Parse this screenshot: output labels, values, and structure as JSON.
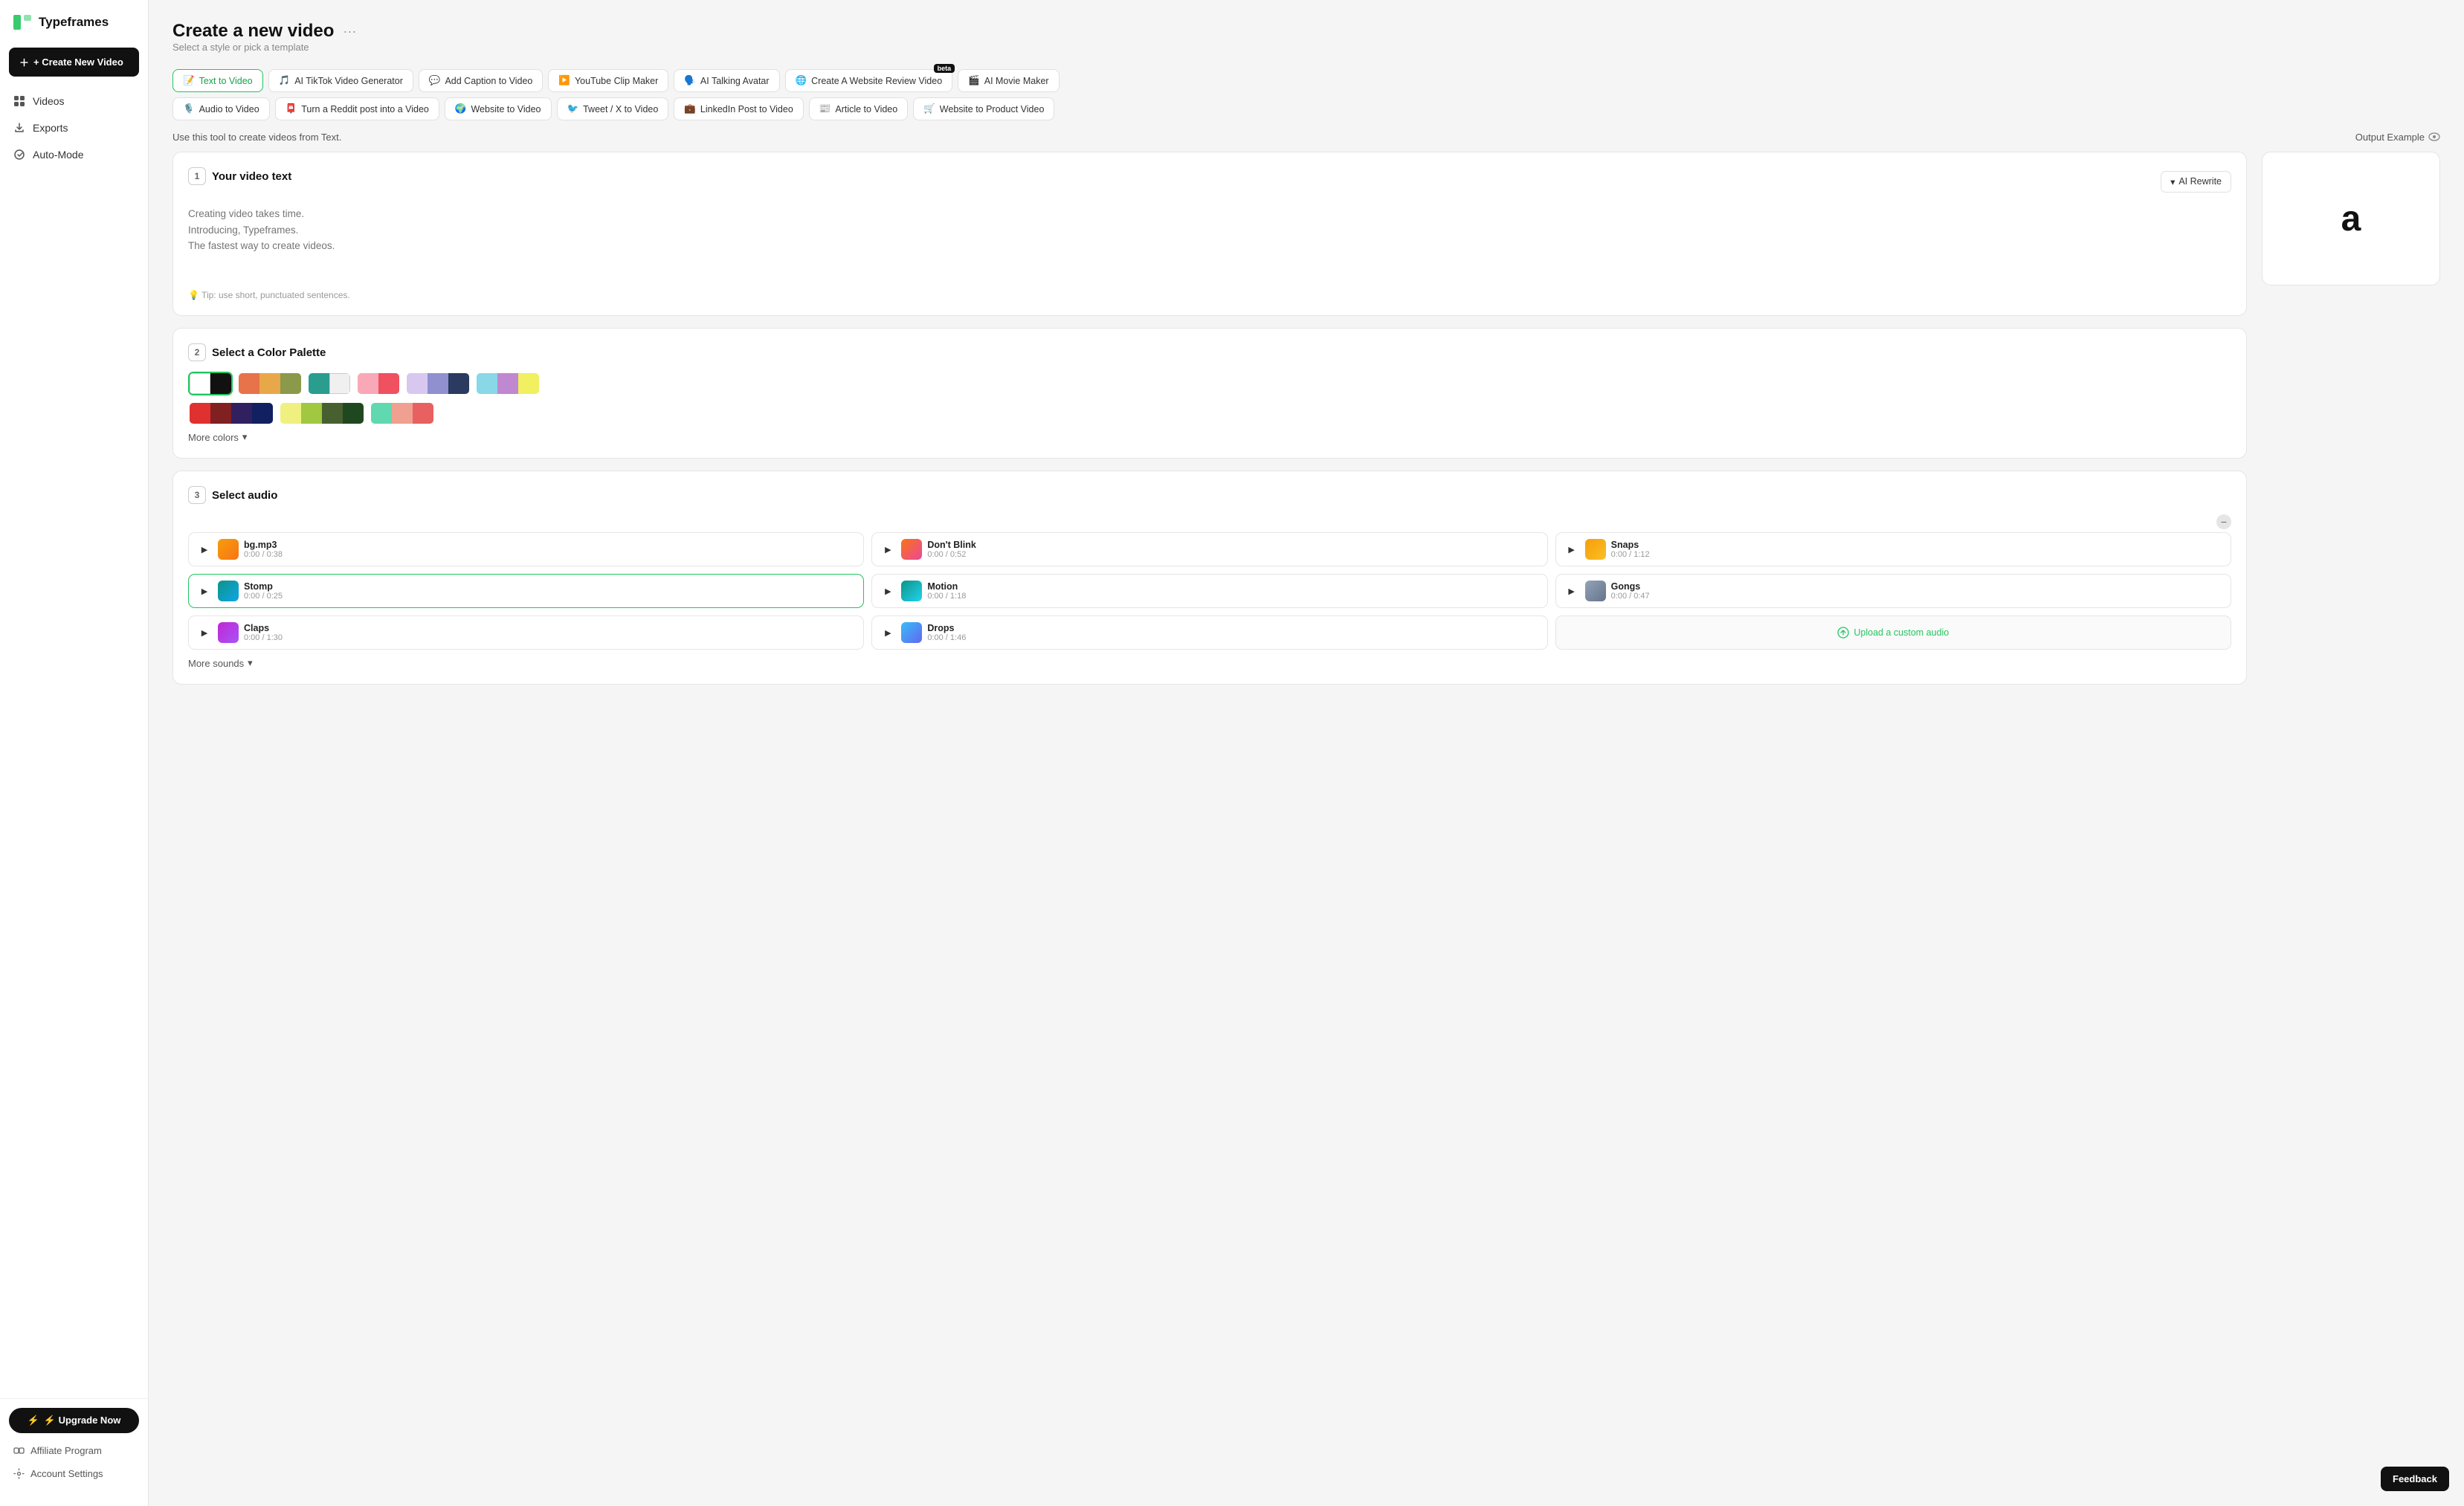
{
  "app": {
    "name": "Typeframes"
  },
  "sidebar": {
    "create_label": "+ Create New Video",
    "upgrade_label": "⚡ Upgrade Now",
    "nav_items": [
      {
        "id": "videos",
        "label": "Videos",
        "icon": "grid"
      },
      {
        "id": "exports",
        "label": "Exports",
        "icon": "export"
      },
      {
        "id": "auto-mode",
        "label": "Auto-Mode",
        "icon": "auto"
      }
    ],
    "bottom_items": [
      {
        "id": "affiliate",
        "label": "Affiliate Program",
        "icon": "affiliate"
      },
      {
        "id": "account",
        "label": "Account Settings",
        "icon": "settings"
      }
    ]
  },
  "page": {
    "title": "Create a new video",
    "subtitle": "Select a style or pick a template"
  },
  "tabs_row1": [
    {
      "id": "text-to-video",
      "label": "Text to Video",
      "icon": "📝",
      "active": true
    },
    {
      "id": "tiktok-generator",
      "label": "AI TikTok Video Generator",
      "icon": "🎵",
      "active": false
    },
    {
      "id": "add-caption",
      "label": "Add Caption to Video",
      "icon": "💬",
      "active": false
    },
    {
      "id": "youtube-clip",
      "label": "YouTube Clip Maker",
      "icon": "▶️",
      "active": false
    },
    {
      "id": "talking-avatar",
      "label": "AI Talking Avatar",
      "icon": "🗣️",
      "active": false
    },
    {
      "id": "website-review",
      "label": "Create A Website Review Video",
      "icon": "🌐",
      "active": false,
      "beta": true
    },
    {
      "id": "movie-maker",
      "label": "AI Movie Maker",
      "icon": "🎬",
      "active": false
    }
  ],
  "tabs_row2": [
    {
      "id": "audio-to-video",
      "label": "Audio to Video",
      "icon": "🎙️"
    },
    {
      "id": "reddit-post",
      "label": "Turn a Reddit post into a Video",
      "icon": "📮"
    },
    {
      "id": "website-to-video",
      "label": "Website to Video",
      "icon": "🌍"
    },
    {
      "id": "tweet-to-video",
      "label": "Tweet / X to Video",
      "icon": "🐦"
    },
    {
      "id": "linkedin-post",
      "label": "LinkedIn Post to Video",
      "icon": "💼"
    },
    {
      "id": "article-to-video",
      "label": "Article to Video",
      "icon": "📰"
    },
    {
      "id": "website-product",
      "label": "Website to Product Video",
      "icon": "🛒"
    }
  ],
  "tool_description": "Use this tool to create videos from Text.",
  "output_example_label": "Output Example",
  "sections": {
    "video_text": {
      "num": "1",
      "title": "Your video text",
      "ai_rewrite_label": "AI Rewrite",
      "placeholder": "Creating video takes time.\nIntroducing, Typeframes.\nThe fastest way to create videos.",
      "tip": "💡 Tip: use short, punctuated sentences."
    },
    "color_palette": {
      "num": "2",
      "title": "Select a Color Palette",
      "more_colors_label": "More colors",
      "palettes": [
        {
          "id": "bw",
          "colors": [
            "#ffffff",
            "#111111"
          ],
          "selected": true
        },
        {
          "id": "warm1",
          "colors": [
            "#e8724a",
            "#e8a84a",
            "#8a9a4a"
          ]
        },
        {
          "id": "teal-white",
          "colors": [
            "#2a9d8f",
            "#f0f0f0"
          ]
        },
        {
          "id": "pink-red",
          "colors": [
            "#f9a8b8",
            "#f05060"
          ]
        },
        {
          "id": "lavender",
          "colors": [
            "#d8c8f0",
            "#9090d0",
            "#2a3a60"
          ]
        },
        {
          "id": "mint-purple",
          "colors": [
            "#88d8e8",
            "#c088d0",
            "#f0f060"
          ]
        },
        {
          "id": "red-dark",
          "colors": [
            "#e03030",
            "#802020",
            "#302060",
            "#102060"
          ]
        },
        {
          "id": "yellow-green",
          "colors": [
            "#f0f080",
            "#a0c840",
            "#486030",
            "#204820"
          ]
        },
        {
          "id": "mint-salmon",
          "colors": [
            "#60d8b0",
            "#f0a090",
            "#e86060"
          ]
        }
      ]
    },
    "audio": {
      "num": "3",
      "title": "Select audio",
      "more_sounds_label": "More sounds",
      "tracks": [
        {
          "id": "bg-mp3",
          "name": "bg.mp3",
          "time": "0:00 / 0:38",
          "color1": "#f59e0b",
          "color2": "#f59e0b"
        },
        {
          "id": "dont-blink",
          "name": "Don't Blink",
          "time": "0:00 / 0:52",
          "color1": "#f97316",
          "color2": "#ec4899"
        },
        {
          "id": "snaps",
          "name": "Snaps",
          "time": "0:00 / 1:12",
          "color1": "#f59e0b",
          "color2": "#fbbf24"
        },
        {
          "id": "stomp",
          "name": "Stomp",
          "time": "0:00 / 0:25",
          "color1": "#0d9488",
          "color2": "#0ea5e9",
          "selected": true
        },
        {
          "id": "motion",
          "name": "Motion",
          "time": "0:00 / 1:18",
          "color1": "#0d9488",
          "color2": "#22d3ee"
        },
        {
          "id": "gongs",
          "name": "Gongs",
          "time": "0:00 / 0:47",
          "color1": "#94a3b8",
          "color2": "#64748b"
        },
        {
          "id": "claps",
          "name": "Claps",
          "time": "0:00 / 1:30",
          "color1": "#c026d3",
          "color2": "#a855f7"
        },
        {
          "id": "drops",
          "name": "Drops",
          "time": "0:00 / 1:46",
          "color1": "#38bdf8",
          "color2": "#6366f1"
        }
      ],
      "upload_label": "Upload a custom audio"
    }
  },
  "preview": {
    "letter": "a"
  },
  "feedback_label": "Feedback"
}
